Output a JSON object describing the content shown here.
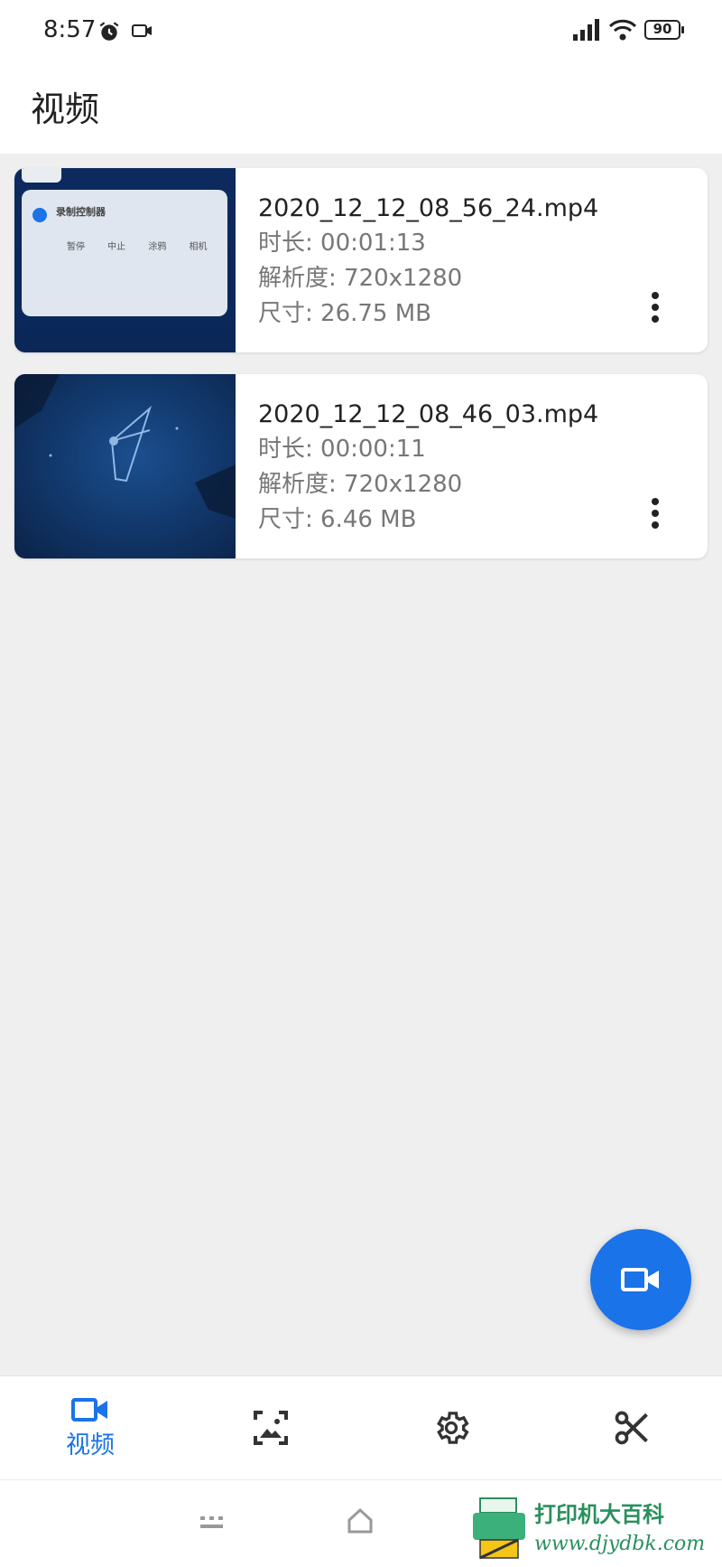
{
  "status_bar": {
    "time": "8:57",
    "battery": "90",
    "icons": [
      "alarm-icon",
      "screen-record-icon",
      "signal-icon",
      "wifi-icon",
      "battery-icon"
    ]
  },
  "app_bar": {
    "title": "视频"
  },
  "videos": [
    {
      "filename": "2020_12_12_08_56_24.mp4",
      "duration": "时长: 00:01:13",
      "resolution": "解析度: 720x1280",
      "size": "尺寸: 26.75 MB",
      "thumb_title": "录制控制器",
      "thumb_labels": "暂停 中止 涂鸦 相机"
    },
    {
      "filename": "2020_12_12_08_46_03.mp4",
      "duration": "时长: 00:00:11",
      "resolution": "解析度: 720x1280",
      "size": "尺寸: 6.46 MB"
    }
  ],
  "fab": {
    "icon": "video-camera-icon"
  },
  "bottom_nav": {
    "items": [
      {
        "icon": "video-camera-icon",
        "label": "视频",
        "active": true
      },
      {
        "icon": "image-icon",
        "label": ""
      },
      {
        "icon": "gear-icon",
        "label": ""
      },
      {
        "icon": "scissors-icon",
        "label": ""
      }
    ]
  },
  "colors": {
    "accent": "#1a73e8",
    "background": "#efefef"
  },
  "watermark": {
    "text": "打印机大百科",
    "url": "www.djydbk.com"
  }
}
